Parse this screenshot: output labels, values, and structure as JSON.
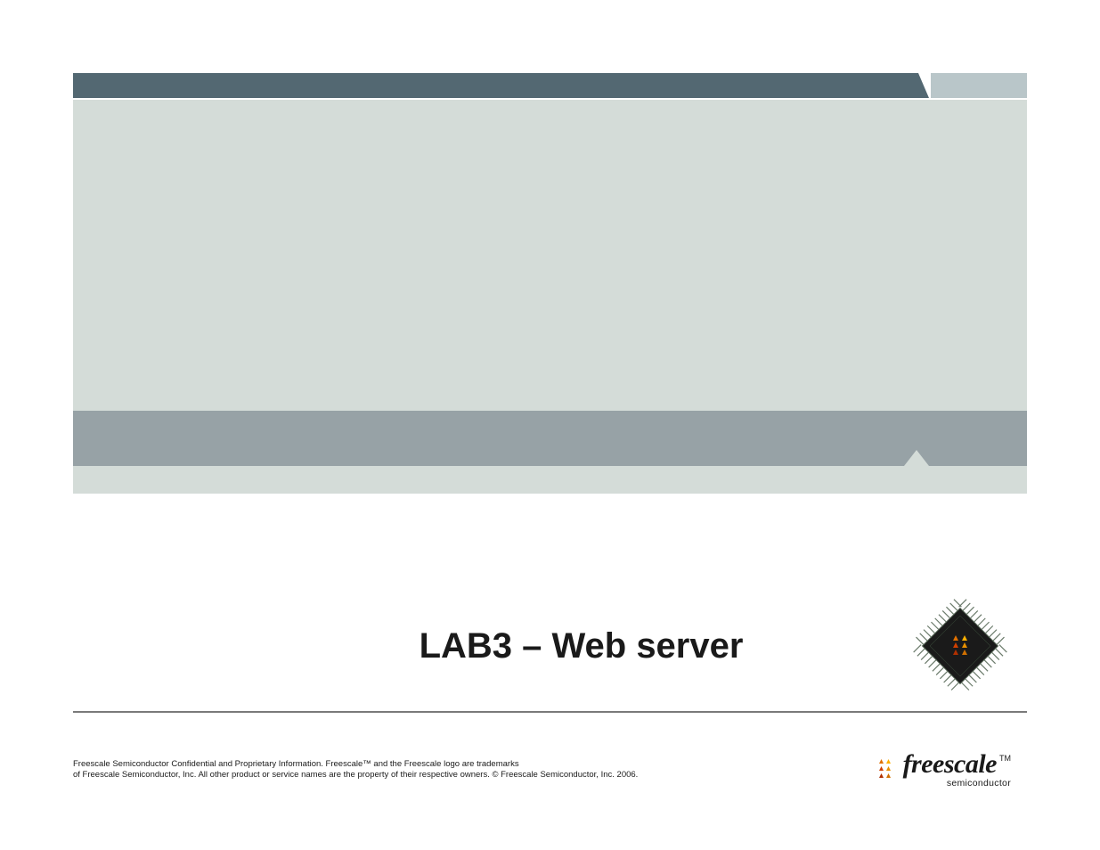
{
  "slide": {
    "title": "LAB3 – Web server"
  },
  "logo": {
    "name": "freescale",
    "sub": "semiconductor",
    "tm": "TM"
  },
  "footer": {
    "disclaimer_line1": "Freescale Semiconductor Confidential and Proprietary Information. Freescale™ and the Freescale logo are trademarks",
    "disclaimer_line2": "of Freescale Semiconductor, Inc. All other product or service names are the property of their respective owners. © Freescale Semiconductor, Inc. 2006."
  },
  "icons": {
    "chip": "chip-icon",
    "brand": "freescale-logo-icon"
  }
}
